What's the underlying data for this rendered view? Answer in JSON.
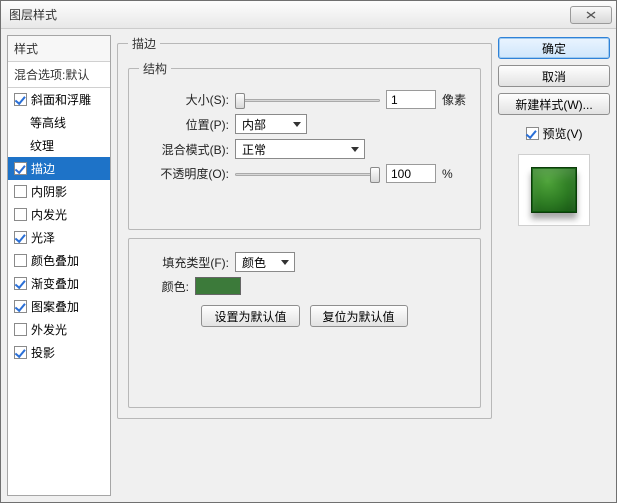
{
  "dialog": {
    "title": "图层样式"
  },
  "left": {
    "header": "样式",
    "blending": "混合选项:默认",
    "items": [
      {
        "label": "斜面和浮雕",
        "checked": true,
        "selected": false,
        "indent": false
      },
      {
        "label": "等高线",
        "checked": false,
        "selected": false,
        "indent": true
      },
      {
        "label": "纹理",
        "checked": false,
        "selected": false,
        "indent": true
      },
      {
        "label": "描边",
        "checked": true,
        "selected": true,
        "indent": false
      },
      {
        "label": "内阴影",
        "checked": false,
        "selected": false,
        "indent": false
      },
      {
        "label": "内发光",
        "checked": false,
        "selected": false,
        "indent": false
      },
      {
        "label": "光泽",
        "checked": true,
        "selected": false,
        "indent": false
      },
      {
        "label": "颜色叠加",
        "checked": false,
        "selected": false,
        "indent": false
      },
      {
        "label": "渐变叠加",
        "checked": true,
        "selected": false,
        "indent": false
      },
      {
        "label": "图案叠加",
        "checked": true,
        "selected": false,
        "indent": false
      },
      {
        "label": "外发光",
        "checked": false,
        "selected": false,
        "indent": false
      },
      {
        "label": "投影",
        "checked": true,
        "selected": false,
        "indent": false
      }
    ]
  },
  "stroke": {
    "group_label": "描边",
    "structure_label": "结构",
    "size_label": "大小(S):",
    "size_value": "1",
    "size_unit": "像素",
    "position_label": "位置(P):",
    "position_value": "内部",
    "blend_label": "混合模式(B):",
    "blend_value": "正常",
    "opacity_label": "不透明度(O):",
    "opacity_value": "100",
    "opacity_unit": "%",
    "fill_type_label": "填充类型(F):",
    "fill_type_value": "颜色",
    "color_label": "颜色:",
    "color_value": "#3c7a3a",
    "btn_default": "设置为默认值",
    "btn_reset": "复位为默认值"
  },
  "right": {
    "ok": "确定",
    "cancel": "取消",
    "new_style": "新建样式(W)...",
    "preview_label": "预览(V)",
    "preview_checked": true
  }
}
